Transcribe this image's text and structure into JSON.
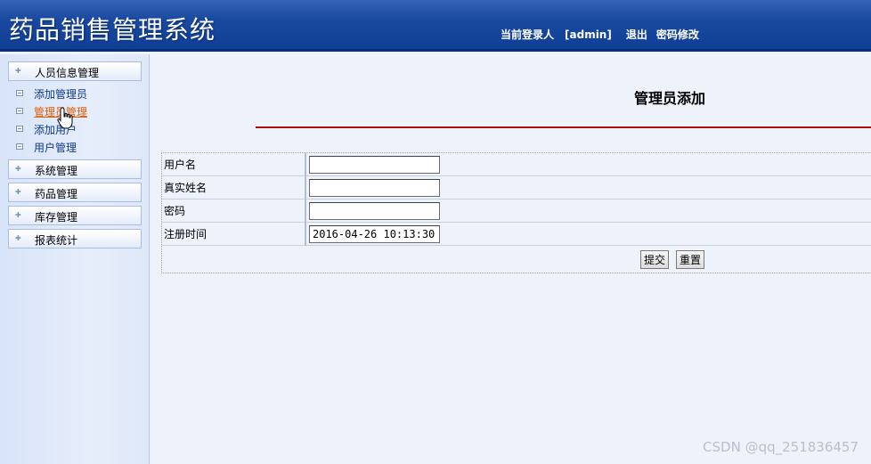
{
  "header": {
    "app_title": "药品销售管理系统",
    "current_user_label": "当前登录人",
    "current_user": "[admin]",
    "logout": "退出",
    "change_password": "密码修改"
  },
  "sidebar": {
    "groups": [
      {
        "label": "人员信息管理"
      },
      {
        "label": "系统管理"
      },
      {
        "label": "药品管理"
      },
      {
        "label": "库存管理"
      },
      {
        "label": "报表统计"
      }
    ],
    "sub_items": [
      {
        "label": "添加管理员"
      },
      {
        "label": "管理员管理",
        "active": true
      },
      {
        "label": "添加用户"
      },
      {
        "label": "用户管理"
      }
    ]
  },
  "main": {
    "page_title": "管理员添加",
    "form": {
      "username_label": "用户名",
      "username_value": "",
      "realname_label": "真实姓名",
      "realname_value": "",
      "password_label": "密码",
      "password_value": "",
      "regtime_label": "注册时间",
      "regtime_value": "2016-04-26 10:13:30",
      "submit_label": "提交",
      "reset_label": "重置"
    }
  },
  "watermark": "CSDN @qq_251836457"
}
